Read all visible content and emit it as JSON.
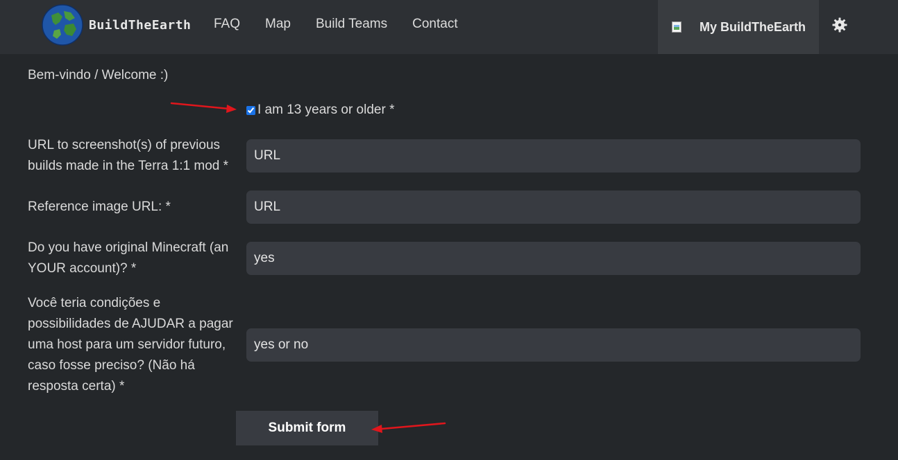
{
  "navbar": {
    "brand": "BuildTheEarth",
    "links": [
      "FAQ",
      "Map",
      "Build Teams",
      "Contact"
    ],
    "my_account": "My BuildTheEarth",
    "theme_icon": "gear-icon"
  },
  "form": {
    "welcome": "Bem-vindo / Welcome :)",
    "age_check": {
      "label": "I am 13 years or older *",
      "checked": true
    },
    "screenshots": {
      "label": "URL to screenshot(s) of previous builds made in the Terra 1:1 mod *",
      "placeholder": "URL"
    },
    "reference": {
      "label": "Reference image URL: *",
      "placeholder": "URL"
    },
    "minecraft": {
      "label": "Do you have original Minecraft (an YOUR account)? *",
      "placeholder": "yes"
    },
    "host": {
      "label": "Você teria condições e possibilidades de AJUDAR a pagar uma host para um servidor futuro, caso fosse preciso? (Não há resposta certa) *",
      "placeholder": "yes or no"
    },
    "submit": "Submit form"
  },
  "colors": {
    "page_bg": "#24272a",
    "navbar_bg": "#2d3034",
    "field_bg": "#383b41",
    "annotation_arrow": "#e0161c"
  }
}
